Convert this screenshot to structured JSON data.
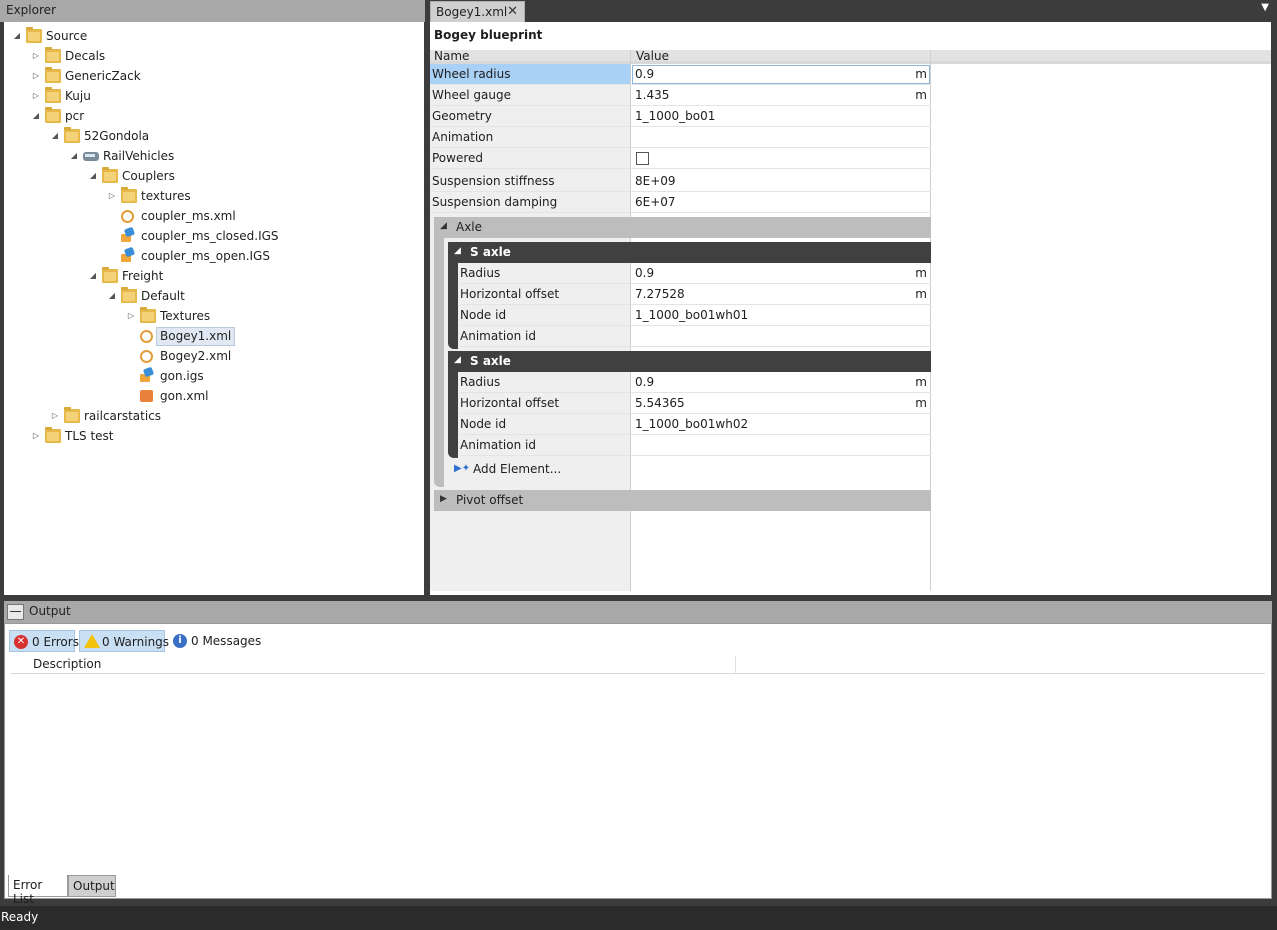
{
  "explorer": {
    "title": "Explorer",
    "tree": [
      {
        "label": "Source",
        "indent": 0,
        "toggle": "open",
        "icon": "folder-icon"
      },
      {
        "label": "Decals",
        "indent": 1,
        "toggle": "closed",
        "icon": "folder-icon"
      },
      {
        "label": "GenericZack",
        "indent": 1,
        "toggle": "closed",
        "icon": "folder-icon"
      },
      {
        "label": "Kuju",
        "indent": 1,
        "toggle": "closed",
        "icon": "folder-icon"
      },
      {
        "label": "pcr",
        "indent": 1,
        "toggle": "open",
        "icon": "folder-icon"
      },
      {
        "label": "52Gondola",
        "indent": 2,
        "toggle": "open",
        "icon": "folder-icon"
      },
      {
        "label": "RailVehicles",
        "indent": 3,
        "toggle": "open",
        "icon": "rail-vehicle-icon"
      },
      {
        "label": "Couplers",
        "indent": 4,
        "toggle": "open",
        "icon": "folder-icon"
      },
      {
        "label": "textures",
        "indent": 5,
        "toggle": "closed",
        "icon": "folder-icon"
      },
      {
        "label": "coupler_ms.xml",
        "indent": 5,
        "toggle": "",
        "icon": "xml-file-icon"
      },
      {
        "label": "coupler_ms_closed.IGS",
        "indent": 5,
        "toggle": "",
        "icon": "igs-file-icon"
      },
      {
        "label": "coupler_ms_open.IGS",
        "indent": 5,
        "toggle": "",
        "icon": "igs-file-icon"
      },
      {
        "label": "Freight",
        "indent": 4,
        "toggle": "open",
        "icon": "folder-icon"
      },
      {
        "label": "Default",
        "indent": 5,
        "toggle": "open",
        "icon": "folder-icon"
      },
      {
        "label": "Textures",
        "indent": 6,
        "toggle": "closed",
        "icon": "folder-icon"
      },
      {
        "label": "Bogey1.xml",
        "indent": 6,
        "toggle": "",
        "icon": "xml-file-icon",
        "selected": true
      },
      {
        "label": "Bogey2.xml",
        "indent": 6,
        "toggle": "",
        "icon": "xml-file-icon"
      },
      {
        "label": "gon.igs",
        "indent": 6,
        "toggle": "",
        "icon": "igs-file-icon"
      },
      {
        "label": "gon.xml",
        "indent": 6,
        "toggle": "",
        "icon": "blueprint-xml-icon"
      },
      {
        "label": "railcarstatics",
        "indent": 2,
        "toggle": "closed",
        "icon": "folder-icon"
      },
      {
        "label": "TLS test",
        "indent": 1,
        "toggle": "closed",
        "icon": "folder-icon"
      }
    ]
  },
  "editor": {
    "tab_label": "Bogey1.xml",
    "close_glyph": "✕",
    "dropdown_glyph": "▼",
    "blueprint_title": "Bogey blueprint",
    "col_name": "Name",
    "col_value": "Value",
    "properties": [
      {
        "name": "Wheel radius",
        "value": "0.9",
        "unit": "m",
        "selected": true
      },
      {
        "name": "Wheel gauge",
        "value": "1.435",
        "unit": "m"
      },
      {
        "name": "Geometry",
        "value": "1_1000_bo01",
        "unit": ""
      },
      {
        "name": "Animation",
        "value": "",
        "unit": ""
      },
      {
        "name": "Powered",
        "value": "",
        "unit": "",
        "checkbox": true,
        "checked": false
      },
      {
        "name": "Suspension stiffness",
        "value": "8E+09",
        "unit": ""
      },
      {
        "name": "Suspension damping",
        "value": "6E+07",
        "unit": ""
      }
    ],
    "axle_group": {
      "label": "Axle",
      "toggle": "◢",
      "elements": [
        {
          "label": "S axle",
          "toggle": "◢",
          "props": [
            {
              "name": "Radius",
              "value": "0.9",
              "unit": "m"
            },
            {
              "name": "Horizontal offset",
              "value": "7.27528",
              "unit": "m"
            },
            {
              "name": "Node id",
              "value": "1_1000_bo01wh01",
              "unit": ""
            },
            {
              "name": "Animation id",
              "value": "",
              "unit": ""
            }
          ]
        },
        {
          "label": "S axle",
          "toggle": "◢",
          "props": [
            {
              "name": "Radius",
              "value": "0.9",
              "unit": "m"
            },
            {
              "name": "Horizontal offset",
              "value": "5.54365",
              "unit": "m"
            },
            {
              "name": "Node id",
              "value": "1_1000_bo01wh02",
              "unit": ""
            },
            {
              "name": "Animation id",
              "value": "",
              "unit": ""
            }
          ]
        }
      ],
      "add_element_label": "Add Element..."
    },
    "pivot_group": {
      "label": "Pivot offset",
      "toggle": "▶"
    }
  },
  "output": {
    "title": "Output",
    "collapse_glyph": "—",
    "filters": [
      {
        "label": "0 Errors",
        "icon": "error-icon",
        "glyph": "✕",
        "active": true
      },
      {
        "label": "0 Warnings",
        "icon": "warning-icon",
        "glyph": "!",
        "active": true
      },
      {
        "label": "0 Messages",
        "icon": "info-icon",
        "glyph": "i",
        "active": false
      }
    ],
    "description_header": "Description",
    "tabs": [
      "Error List",
      "Output"
    ]
  },
  "status": {
    "text": "Ready"
  }
}
